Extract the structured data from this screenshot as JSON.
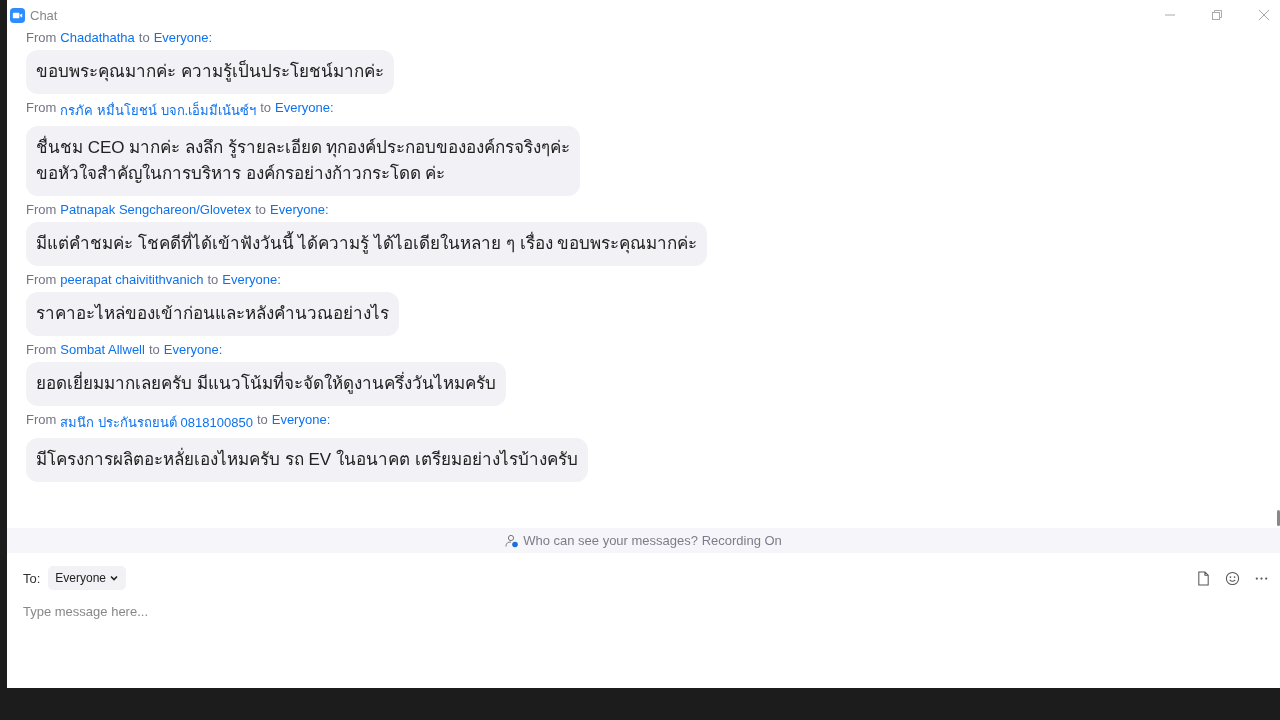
{
  "window": {
    "title": "Chat"
  },
  "messages": [
    {
      "from_label": "From",
      "sender": "Chadathatha",
      "to_label": "to",
      "recipient": "Everyone:",
      "lines": [
        "ขอบพระคุณมากค่ะ  ความรู้เป็นประโยชน์มากค่ะ"
      ]
    },
    {
      "from_label": "From",
      "sender": "กรภัค หมื่นโยชน์ บจก.เอ็มมีเน้นซ์ฯ",
      "to_label": "to",
      "recipient": "Everyone:",
      "lines": [
        "ชื่นชม CEO มากค่ะ ลงลึก รู้รายละเอียด ทุกองค์ประกอบขององค์กรจริงๆค่ะ",
        "ขอหัวใจสำคัญในการบริหาร องค์กรอย่างก้าวกระโดด ค่ะ"
      ]
    },
    {
      "from_label": "From",
      "sender": "Patnapak Sengchareon/Glovetex",
      "to_label": "to",
      "recipient": "Everyone:",
      "lines": [
        "มีแต่คำชมค่ะ โชคดีที่ได้เข้าฟังวันนี้ ได้ความรู้ ได้ไอเดียในหลาย ๆ เรื่อง  ขอบพระคุณมากค่ะ"
      ]
    },
    {
      "from_label": "From",
      "sender": "peerapat chaivitithvanich",
      "to_label": "to",
      "recipient": "Everyone:",
      "lines": [
        "ราคาอะไหล่ของเข้าก่อนและหลังคำนวณอย่างไร"
      ]
    },
    {
      "from_label": "From",
      "sender": "Sombat Allwell",
      "to_label": "to",
      "recipient": "Everyone:",
      "lines": [
        "ยอดเยี่ยมมากเลยครับ มีแนวโน้มที่จะจัดให้ดูงานครึ่งวันไหมครับ"
      ]
    },
    {
      "from_label": "From",
      "sender": "สมนึก ประกันรถยนต์ 0818100850",
      "to_label": "to",
      "recipient": "Everyone:",
      "lines": [
        "มีโครงการผลิตอะหลั่ยเองไหมครับ รถ EV ในอนาคต เตรียมอย่างไรบ้างครับ"
      ]
    }
  ],
  "notice": "Who can see your messages? Recording On",
  "composer": {
    "to_label": "To:",
    "recipient": "Everyone",
    "placeholder": "Type message here..."
  }
}
